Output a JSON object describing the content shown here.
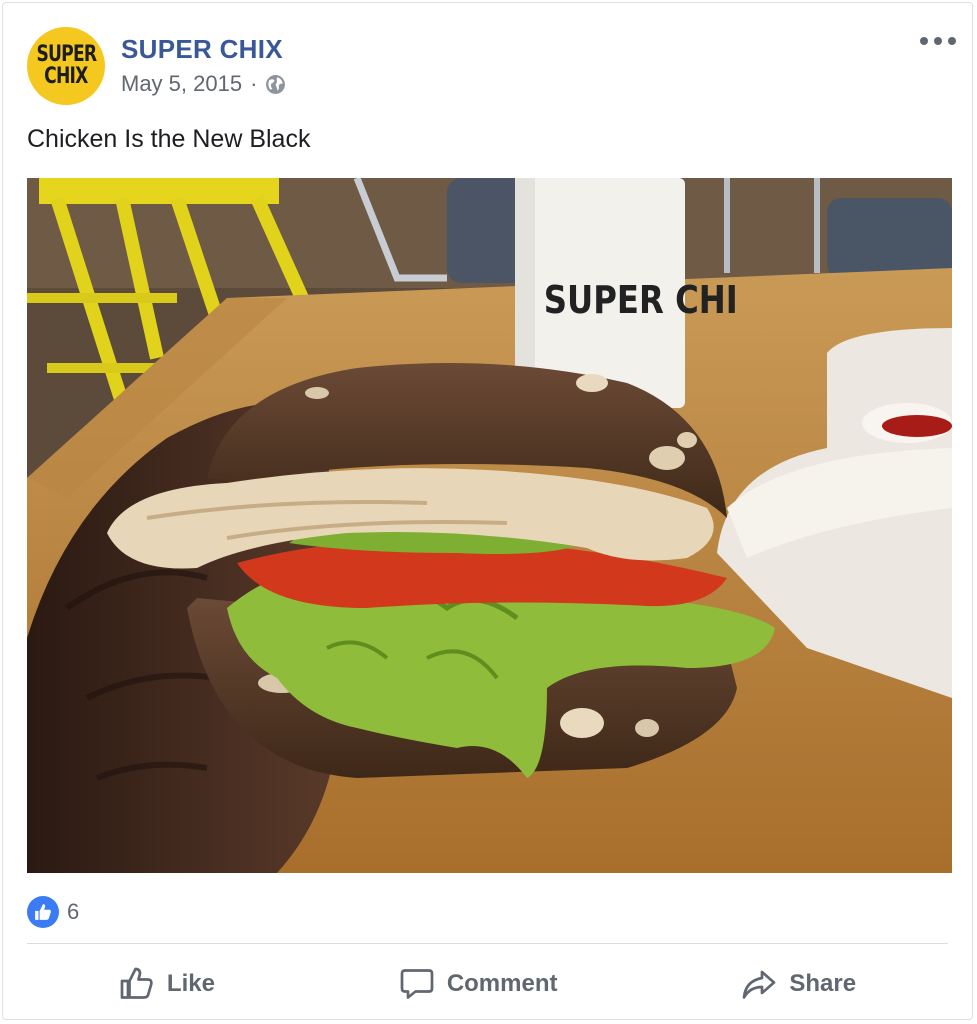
{
  "post": {
    "author": "SUPER CHIX",
    "date": "May 5, 2015",
    "separator": "·",
    "privacy_icon": "globe-icon",
    "text": "Chicken Is the New Black",
    "photo_cup_text": "SUPER CHI"
  },
  "avatar": {
    "line1": "SUPER",
    "line2": "CHIX",
    "color": "#f5c81f"
  },
  "reactions": {
    "type": "like",
    "count": "6",
    "color": "#3b7cf5"
  },
  "actions": {
    "like": "Like",
    "comment": "Comment",
    "share": "Share"
  },
  "colors": {
    "author_link": "#385898",
    "muted": "#606770"
  }
}
